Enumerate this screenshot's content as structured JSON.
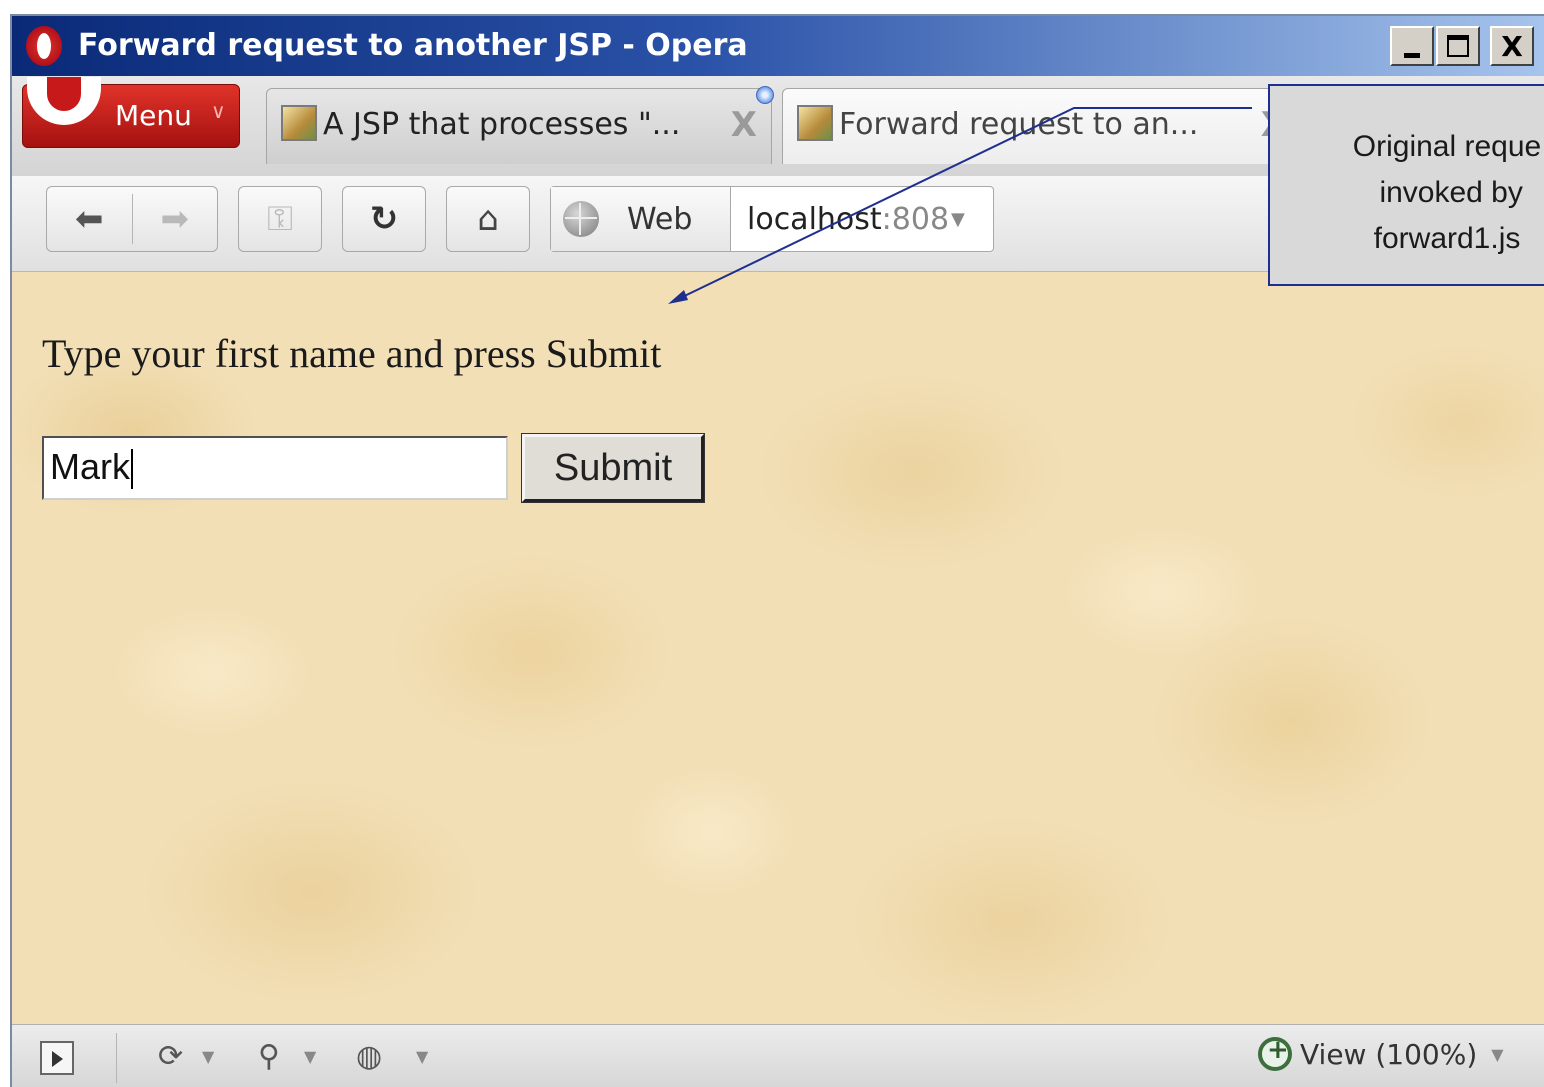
{
  "window": {
    "title": "Forward request to another JSP - Opera",
    "controls": {
      "minimize": "_",
      "maximize": "□",
      "close": "X"
    }
  },
  "menu": {
    "label": "Menu",
    "chevron": "∨"
  },
  "tabs": [
    {
      "label": "A JSP that processes \"...",
      "close": "X",
      "active": false
    },
    {
      "label": "Forward request to an...",
      "close": "X",
      "active": true
    }
  ],
  "nav": {
    "back_icon": "⬅",
    "forward_icon": "➡",
    "key_icon": "⚿",
    "reload_icon": "↻",
    "home_icon": "⌂"
  },
  "address": {
    "search_engine": "Web",
    "url_host": "localhost",
    "url_port": ":808("
  },
  "page": {
    "prompt": "Type your first name and press Submit",
    "name_value": "Mark",
    "submit_label": "Submit"
  },
  "status": {
    "zoom_label": "View (100%)"
  },
  "annotation": {
    "text": "Original reque\n invoked by\nforward1.js"
  },
  "colors": {
    "titlebar_start": "#0a2a78",
    "content_bg": "#f2dfb6",
    "callout_border": "#1f2f8f",
    "menu_red": "#c8191a"
  }
}
